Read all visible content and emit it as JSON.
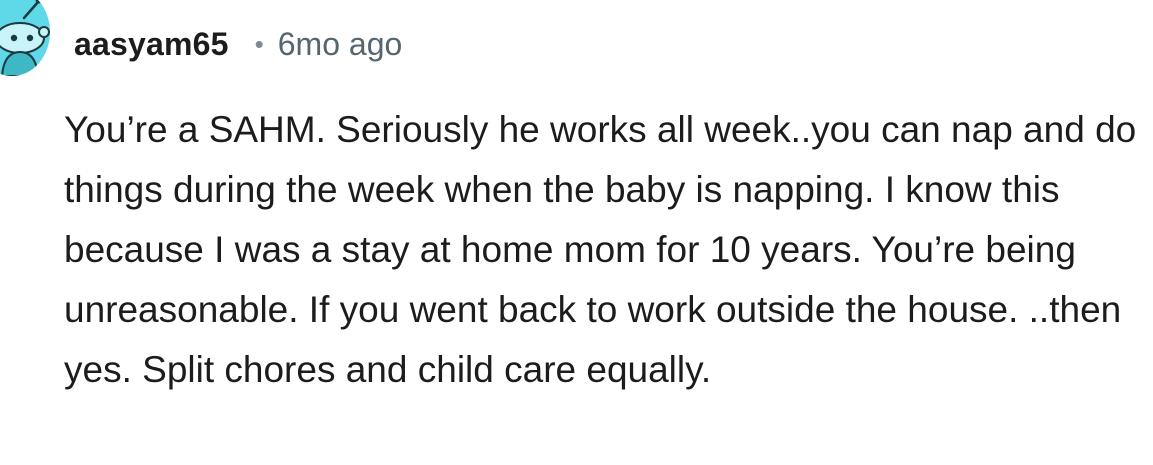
{
  "comment": {
    "username": "aasyam65",
    "separator": "•",
    "timestamp": "6mo ago",
    "avatar_icon": "reddit-snoo-avatar-icon",
    "avatar_color": "#5fd8e8",
    "text": "You’re a SAHM. Seriously he works all week..you can nap and do things during the week when the baby is napping. I know this because I was a stay at home mom for 10 years. You’re being unreasonable. If you went back to work outside the house. ..then yes. Split chores and child care equally."
  }
}
